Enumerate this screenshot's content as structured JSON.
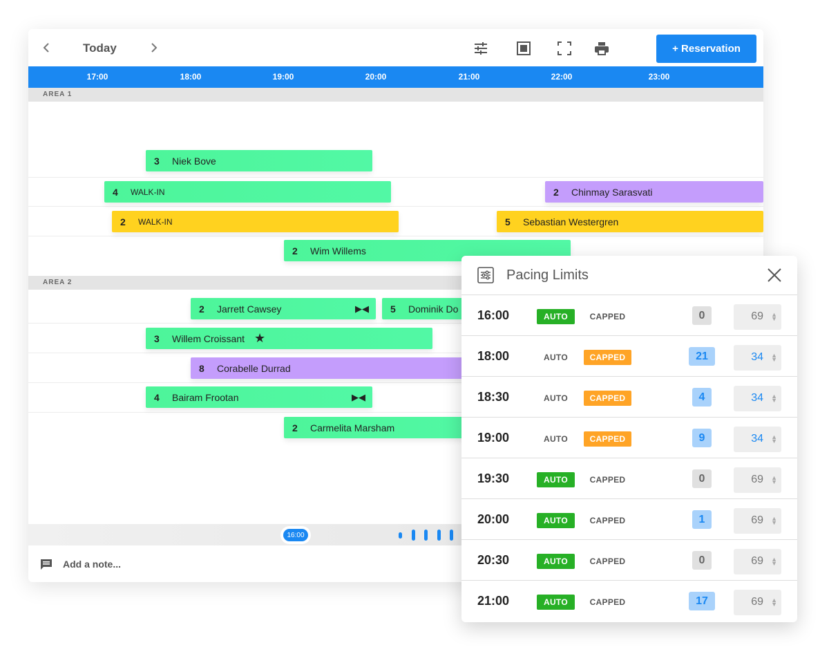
{
  "toolbar": {
    "date_label": "Today",
    "reservation_button": "+ Reservation"
  },
  "timeline": {
    "hours": [
      "17:00",
      "18:00",
      "19:00",
      "20:00",
      "21:00",
      "22:00",
      "23:00"
    ]
  },
  "areas": [
    {
      "label": "AREA 1"
    },
    {
      "label": "AREA 2"
    }
  ],
  "reservations": [
    {
      "count": "3",
      "name": "Niek Bove",
      "color": "green"
    },
    {
      "count": "4",
      "name": "WALK-IN",
      "color": "green"
    },
    {
      "count": "2",
      "name": "Chinmay Sarasvati",
      "color": "purple"
    },
    {
      "count": "2",
      "name": "WALK-IN",
      "color": "yellow"
    },
    {
      "count": "5",
      "name": "Sebastian Westergren",
      "color": "yellow"
    },
    {
      "count": "2",
      "name": "Wim Willems",
      "color": "green"
    },
    {
      "count": "2",
      "name": "Jarrett Cawsey",
      "color": "green"
    },
    {
      "count": "5",
      "name": "Dominik Do",
      "color": "green"
    },
    {
      "count": "3",
      "name": "Willem Croissant",
      "color": "green"
    },
    {
      "count": "8",
      "name": "Corabelle Durrad",
      "color": "purple"
    },
    {
      "count": "4",
      "name": "Bairam Frootan",
      "color": "green"
    },
    {
      "count": "2",
      "name": "Carmelita Marsham",
      "color": "green"
    }
  ],
  "scrubber": {
    "time": "16:00"
  },
  "note": {
    "placeholder": "Add a note..."
  },
  "pacing": {
    "title": "Pacing Limits",
    "auto_label": "AUTO",
    "capped_label": "CAPPED",
    "rows": [
      {
        "time": "16:00",
        "mode": "auto",
        "count": "0",
        "limit": "69"
      },
      {
        "time": "18:00",
        "mode": "capped",
        "count": "21",
        "limit": "34"
      },
      {
        "time": "18:30",
        "mode": "capped",
        "count": "4",
        "limit": "34"
      },
      {
        "time": "19:00",
        "mode": "capped",
        "count": "9",
        "limit": "34"
      },
      {
        "time": "19:30",
        "mode": "auto",
        "count": "0",
        "limit": "69"
      },
      {
        "time": "20:00",
        "mode": "auto",
        "count": "1",
        "limit": "69"
      },
      {
        "time": "20:30",
        "mode": "auto",
        "count": "0",
        "limit": "69"
      },
      {
        "time": "21:00",
        "mode": "auto",
        "count": "17",
        "limit": "69"
      }
    ]
  },
  "colors": {
    "accent": "#1a88f2",
    "green": "#4df59a",
    "purple": "#c49dfc",
    "yellow": "#ffd21f",
    "auto_on": "#27b026",
    "capped_on": "#ffa426"
  }
}
